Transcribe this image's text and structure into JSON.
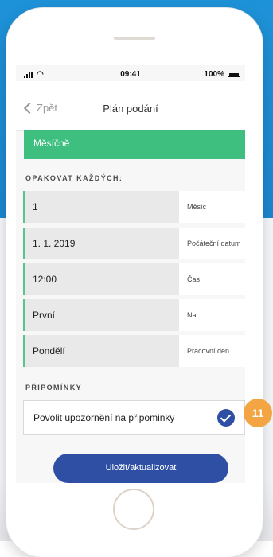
{
  "status_bar": {
    "time": "09:41",
    "battery": "100%"
  },
  "nav": {
    "back_label": "Zpět",
    "title": "Plán podání"
  },
  "frequency": {
    "selected": "Měsíčně"
  },
  "repeat_section": {
    "label": "OPAKOVAT KAŽDÝCH:",
    "rows": [
      {
        "value": "1",
        "label": "Měsíc"
      },
      {
        "value": "1. 1. 2019",
        "label": "Počáteční datum"
      },
      {
        "value": "12:00",
        "label": "Čas"
      },
      {
        "value": "První",
        "label": "Na"
      },
      {
        "value": "Pondělí",
        "label": "Pracovní den"
      }
    ]
  },
  "reminders": {
    "label": "PŘIPOMÍNKY",
    "toggle_label": "Povolit upozornění na připominky",
    "enabled": true
  },
  "save_button": "Uložit/aktualizovat",
  "step_badge": "11",
  "colors": {
    "background_band": "#1e92d8",
    "success_green": "#3fbf7f",
    "primary_blue": "#2e4fa3",
    "badge_orange": "#f3a543"
  }
}
